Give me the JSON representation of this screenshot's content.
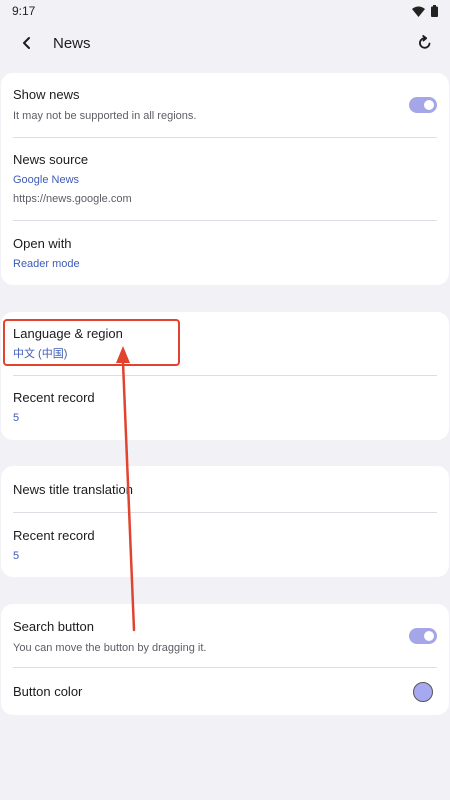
{
  "status_bar": {
    "time": "9:17",
    "icons": [
      "wifi-icon",
      "battery-icon"
    ]
  },
  "app_bar": {
    "title": "News",
    "back_icon": "back-arrow-icon",
    "action_icon": "reset-icon"
  },
  "groups": [
    {
      "rows": [
        {
          "title": "Show news",
          "subtitle": "It may not be supported in all regions.",
          "toggle": true
        },
        {
          "title": "News source",
          "value": "Google News",
          "subtitle": "https://news.google.com"
        },
        {
          "title": "Open with",
          "value": "Reader mode"
        }
      ]
    },
    {
      "rows": [
        {
          "title": "Language & region",
          "value": "中文 (中国)"
        },
        {
          "title": "Recent record",
          "value": "5"
        }
      ]
    },
    {
      "rows": [
        {
          "title": "News title translation"
        },
        {
          "title": "Recent record",
          "value": "5"
        }
      ]
    },
    {
      "rows": [
        {
          "title": "Search button",
          "subtitle": "You can move the button by dragging it.",
          "toggle": true
        },
        {
          "title": "Button color"
        }
      ]
    }
  ],
  "colors": {
    "accent": "#a4a6e8",
    "link_value": "#3e5bb8",
    "swatch": "#a7a9f0",
    "annotation": "#e0442e"
  }
}
